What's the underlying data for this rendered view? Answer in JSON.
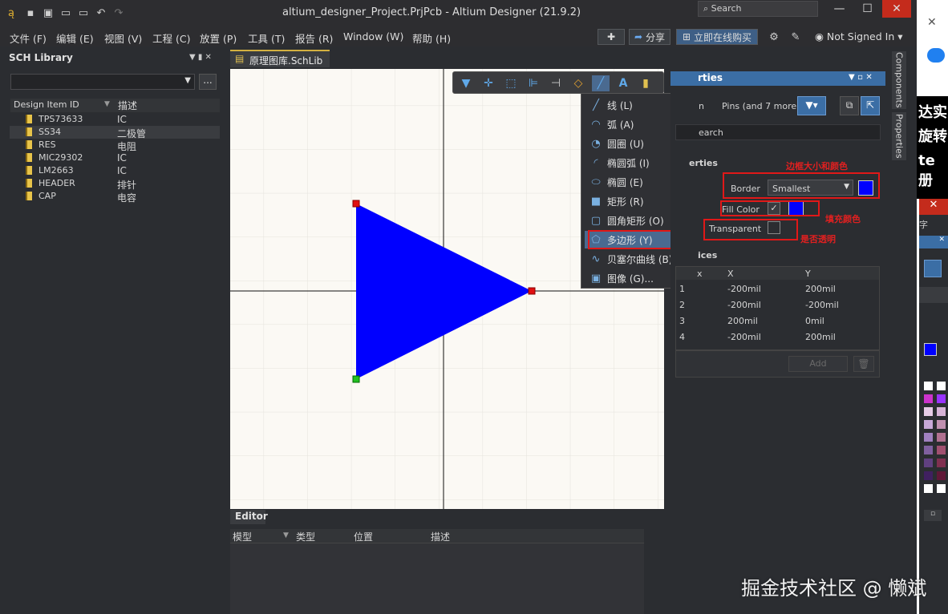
{
  "window": {
    "title": "altium_designer_Project.PrjPcb - Altium Designer (21.9.2)",
    "search_placeholder": "Search"
  },
  "menu": [
    "文件 (F)",
    "编辑 (E)",
    "视图 (V)",
    "工程 (C)",
    "放置 (P)",
    "工具 (T)",
    "报告 (R)",
    "Window (W)",
    "帮助 (H)"
  ],
  "menubar_right": {
    "share": "分享",
    "buy": "立即在线购买",
    "signin": "Not Signed In"
  },
  "left_panel": {
    "title": "SCH Library",
    "browse_button": "...",
    "columns": [
      "Design Item ID",
      "描述"
    ],
    "items": [
      {
        "id": "TPS73633",
        "desc": "IC"
      },
      {
        "id": "SS34",
        "desc": "二极管"
      },
      {
        "id": "RES",
        "desc": "电阻"
      },
      {
        "id": "MIC29302",
        "desc": "IC"
      },
      {
        "id": "LM2663",
        "desc": "IC"
      },
      {
        "id": "HEADER",
        "desc": "排针"
      },
      {
        "id": "CAP",
        "desc": "电容"
      }
    ]
  },
  "doc_tab": "原理图库.SchLib *",
  "dropdown": [
    {
      "label": "线 (L)",
      "icon": "line-icon"
    },
    {
      "label": "弧 (A)",
      "icon": "arc-icon"
    },
    {
      "label": "圆圈 (U)",
      "icon": "circle-icon"
    },
    {
      "label": "椭圆弧 (I)",
      "icon": "elliptical-arc-icon"
    },
    {
      "label": "椭圆 (E)",
      "icon": "ellipse-icon"
    },
    {
      "label": "矩形 (R)",
      "icon": "rectangle-icon"
    },
    {
      "label": "圆角矩形 (O)",
      "icon": "round-rectangle-icon"
    },
    {
      "label": "多边形 (Y)",
      "icon": "polygon-icon"
    },
    {
      "label": "贝塞尔曲线 (B)",
      "icon": "bezier-icon"
    },
    {
      "label": "图像 (G)...",
      "icon": "image-icon"
    }
  ],
  "editor": {
    "tab": "Editor",
    "columns": [
      "模型",
      "类型",
      "位置",
      "描述"
    ]
  },
  "properties": {
    "title": "rties",
    "filter_partial": "n",
    "pins_filter": "Pins (and 7 more)",
    "search_partial": "earch",
    "section_properties": "erties",
    "border_label": "Border",
    "border_value": "Smallest",
    "fill_color_label": "Fill Color",
    "transparent_label": "Transparent",
    "section_vertices": "ices",
    "vertices_cols": [
      "x",
      "X",
      "Y"
    ],
    "vertices": [
      {
        "n": "1",
        "x": "-200mil",
        "y": "200mil"
      },
      {
        "n": "2",
        "x": "-200mil",
        "y": "-200mil"
      },
      {
        "n": "3",
        "x": "200mil",
        "y": "0mil"
      },
      {
        "n": "4",
        "x": "-200mil",
        "y": "200mil"
      }
    ],
    "add_button": "Add",
    "border_color": "#0000ff",
    "fill_color": "#0000ff"
  },
  "annotations": {
    "border_note": "边框大小和颜色",
    "fill_note": "填充颜色",
    "transparent_note": "是否透明"
  },
  "vertical_tabs": [
    "Components",
    "Properties"
  ],
  "right_strip": {
    "line1": "达实",
    "line2": "旋转",
    "line3": "te册",
    "tab": "字"
  },
  "watermark": "掘金技术社区 @ 懒斌",
  "colors": {
    "polygon": "#0000ff",
    "accent": "#3b6ea5",
    "highlight": "#e01818"
  }
}
